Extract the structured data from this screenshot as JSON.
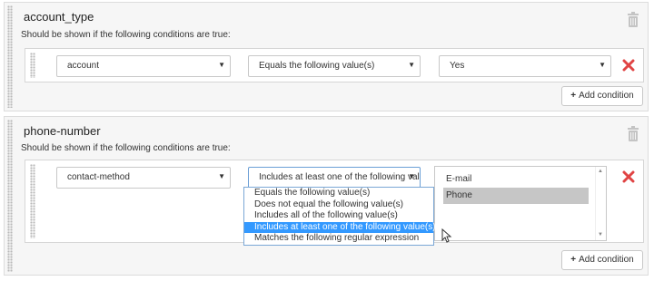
{
  "blocks": [
    {
      "title": "account_type",
      "subtitle": "Should be shown if the following conditions are true:",
      "condition": {
        "field": "account",
        "operator": "Equals the following value(s)",
        "value": "Yes"
      },
      "add_condition_label": "Add condition"
    },
    {
      "title": "phone-number",
      "subtitle": "Should be shown if the following conditions are true:",
      "condition": {
        "field": "contact-method",
        "operator": "Includes at least one of the following value(s)",
        "values": [
          "E-mail",
          "Phone"
        ],
        "selected_value": "Phone"
      },
      "add_condition_label": "Add condition"
    }
  ],
  "operator_dropdown": {
    "options": [
      "Equals the following value(s)",
      "Does not equal the following value(s)",
      "Includes all of the following value(s)",
      "Includes at least one of the following value(s)",
      "Matches the following regular expression"
    ],
    "selected_index": 3
  },
  "icons": {
    "delete_block": "trash-icon",
    "remove_condition": "close-icon",
    "add": "plus-icon",
    "caret": "caret-down-icon",
    "drag": "drag-handle-icon"
  },
  "colors": {
    "remove_red": "#e04444",
    "highlight_blue": "#3399ff",
    "selected_gray": "#c6c6c6"
  }
}
